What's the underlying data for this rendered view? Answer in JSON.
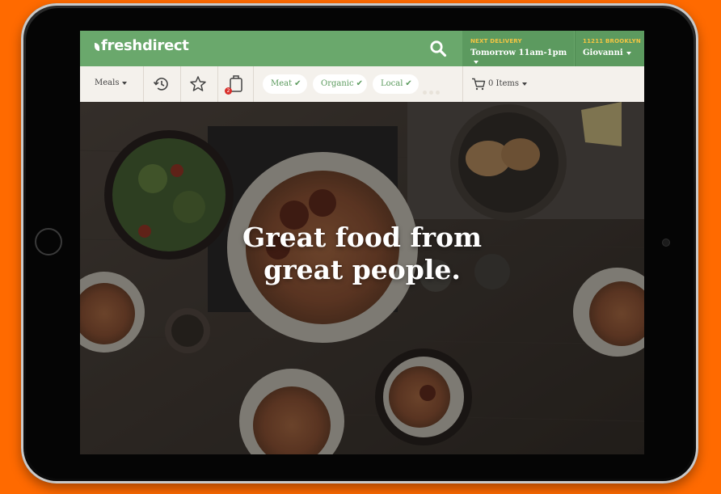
{
  "brand": {
    "logo_text": "freshdirect"
  },
  "header": {
    "delivery_label": "NEXT DELIVERY",
    "delivery_value": "Tomorrow 11am-1pm",
    "location_label": "11211 BROOKLYN",
    "location_value": "Giovanni"
  },
  "toolbar": {
    "meals_label": "Meals",
    "list_badge_count": "2",
    "filters": [
      {
        "label": "Meat",
        "check": "✔"
      },
      {
        "label": "Organic",
        "check": "✔"
      },
      {
        "label": "Local",
        "check": "✔"
      }
    ],
    "cart_label": "0 Items"
  },
  "hero": {
    "headline_line1": "Great food from",
    "headline_line2": "great people."
  },
  "colors": {
    "page_bg": "#ff6a00",
    "header_green": "#6aa86c",
    "header_green_dark": "#5c9a5f",
    "accent_yellow": "#f5c542",
    "toolbar_bg": "#f4f1ec",
    "pill_text": "#5a9a5c",
    "badge_red": "#d9302c"
  },
  "icons": {
    "search": "search-icon",
    "history": "history-icon",
    "favorites": "star-icon",
    "shopping_list": "shopping-list-icon",
    "cart": "cart-icon",
    "more": "more-dots-icon"
  }
}
